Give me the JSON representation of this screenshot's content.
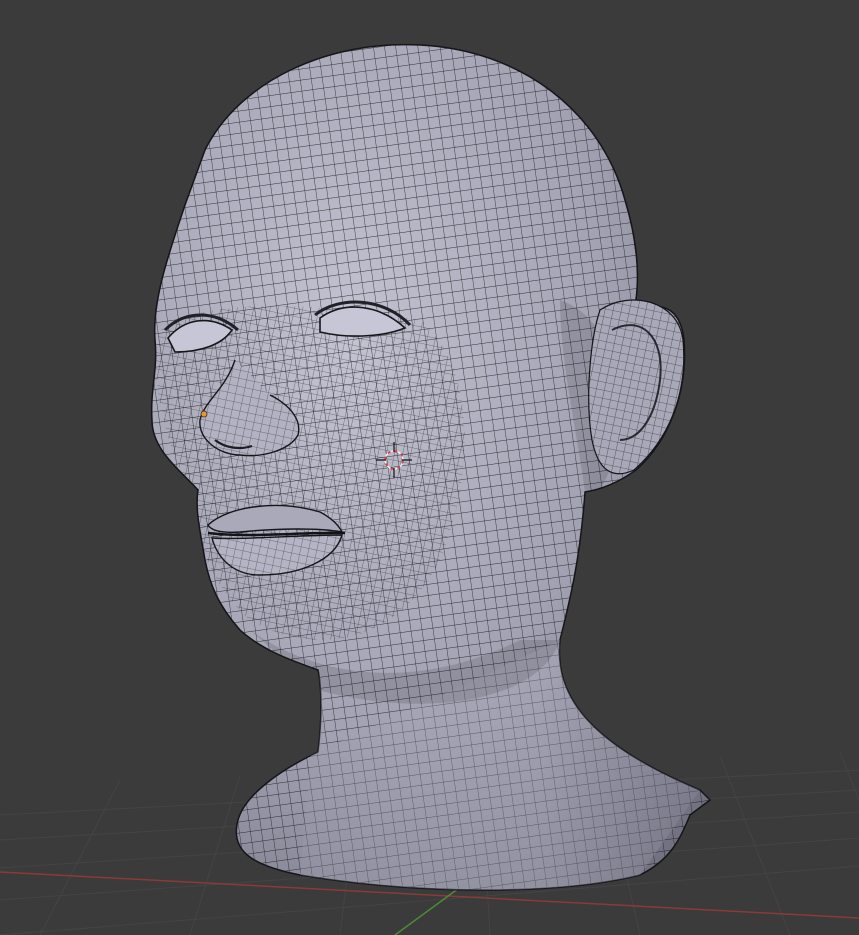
{
  "app": {
    "name": "",
    "view": "3D Viewport"
  },
  "viewport": {
    "background_color": "#3b3b3b",
    "grid_color": "#444444",
    "x_axis_color": "#8a3a3a",
    "y_axis_color": "#4c8a3a",
    "mesh_fill_color": "#a6a6b8",
    "wire_color": "#1b1b20",
    "shading": "solid",
    "wireframe_overlay": true
  },
  "objects": {
    "mesh": "head-bust-mesh",
    "cursor": "3d-cursor",
    "origin": "object-origin-dot"
  }
}
